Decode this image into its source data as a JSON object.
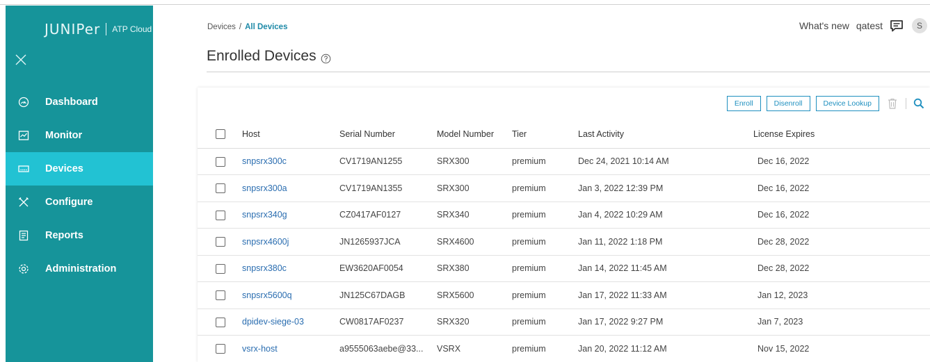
{
  "brand": {
    "logo": "JUNIPer",
    "product": "ATP Cloud"
  },
  "sidebar": {
    "items": [
      {
        "label": "Dashboard",
        "icon": "dashboard-gauge-icon",
        "active": false
      },
      {
        "label": "Monitor",
        "icon": "monitor-chart-icon",
        "active": false
      },
      {
        "label": "Devices",
        "icon": "devices-icon",
        "active": true
      },
      {
        "label": "Configure",
        "icon": "configure-tools-icon",
        "active": false
      },
      {
        "label": "Reports",
        "icon": "reports-document-icon",
        "active": false
      },
      {
        "label": "Administration",
        "icon": "administration-gear-icon",
        "active": false
      }
    ]
  },
  "breadcrumb": {
    "parent": "Devices",
    "separator": "/",
    "current": "All Devices"
  },
  "page": {
    "title": "Enrolled Devices"
  },
  "header": {
    "whats_new": "What's new",
    "user": "qatest",
    "avatar_initial": "S"
  },
  "toolbar": {
    "enroll": "Enroll",
    "disenroll": "Disenroll",
    "device_lookup": "Device Lookup"
  },
  "table": {
    "columns": [
      "Host",
      "Serial Number",
      "Model Number",
      "Tier",
      "Last Activity",
      "License Expires"
    ],
    "rows": [
      {
        "host": "snpsrx300c",
        "serial": "CV1719AN1255",
        "model": "SRX300",
        "tier": "premium",
        "last_activity": "Dec 24, 2021 10:14 AM",
        "license_expires": "Dec 16, 2022"
      },
      {
        "host": "snpsrx300a",
        "serial": "CV1719AN1355",
        "model": "SRX300",
        "tier": "premium",
        "last_activity": "Jan 3, 2022 12:39 PM",
        "license_expires": "Dec 16, 2022"
      },
      {
        "host": "snpsrx340g",
        "serial": "CZ0417AF0127",
        "model": "SRX340",
        "tier": "premium",
        "last_activity": "Jan 4, 2022 10:29 AM",
        "license_expires": "Dec 16, 2022"
      },
      {
        "host": "snpsrx4600j",
        "serial": "JN1265937JCA",
        "model": "SRX4600",
        "tier": "premium",
        "last_activity": "Jan 11, 2022 1:18 PM",
        "license_expires": "Dec 28, 2022"
      },
      {
        "host": "snpsrx380c",
        "serial": "EW3620AF0054",
        "model": "SRX380",
        "tier": "premium",
        "last_activity": "Jan 14, 2022 11:45 AM",
        "license_expires": "Dec 28, 2022"
      },
      {
        "host": "snpsrx5600q",
        "serial": "JN125C67DAGB",
        "model": "SRX5600",
        "tier": "premium",
        "last_activity": "Jan 17, 2022 11:33 AM",
        "license_expires": "Jan 12, 2023"
      },
      {
        "host": "dpidev-siege-03",
        "serial": "CW0817AF0237",
        "model": "SRX320",
        "tier": "premium",
        "last_activity": "Jan 17, 2022 9:27 PM",
        "license_expires": "Jan 7, 2023"
      },
      {
        "host": "vsrx-host",
        "serial": "a9555063aebe@33...",
        "model": "VSRX",
        "tier": "premium",
        "last_activity": "Jan 20, 2022 11:12 AM",
        "license_expires": "Nov 15, 2022"
      }
    ]
  },
  "colors": {
    "sidebar_bg": "#16949a",
    "sidebar_active": "#22c2d3",
    "link": "#2a6db0",
    "accent": "#1e8fbf"
  }
}
